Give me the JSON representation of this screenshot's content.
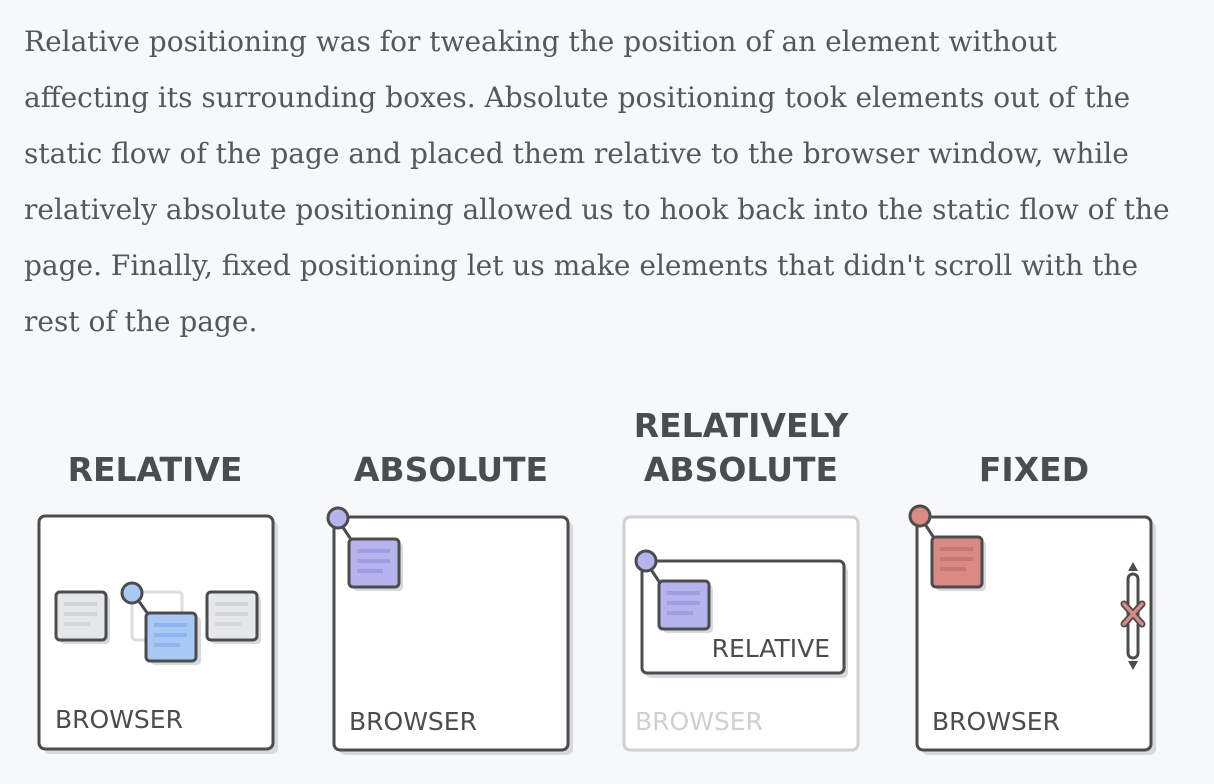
{
  "paragraph": "Relative positioning was for tweaking the position of an element without affecting its surrounding boxes. Absolute positioning took elements out of the static flow of the page and placed them relative to the browser window, while relatively absolute positioning allowed us to hook back into the static flow of the page. Finally, fixed positioning let us make elements that didn't scroll with the rest of the page.",
  "panels": {
    "relative": {
      "title": "RELATIVE",
      "browser_label": "BROWSER"
    },
    "absolute": {
      "title": "ABSOLUTE",
      "browser_label": "BROWSER"
    },
    "relatively_absolute": {
      "title_line1": "RELATIVELY",
      "title_line2": "ABSOLUTE",
      "container_label": "RELATIVE",
      "browser_label": "BROWSER"
    },
    "fixed": {
      "title": "FIXED",
      "browser_label": "BROWSER"
    }
  },
  "colors": {
    "outline": "#4b4c4e",
    "shadow": "#d8d9dc",
    "gray_box": "#e6e7e8",
    "blue_box": "#aac8f4",
    "purple_box": "#b7b3ec",
    "red_box": "#d98a84",
    "faded_outline": "#cfd0d1"
  }
}
